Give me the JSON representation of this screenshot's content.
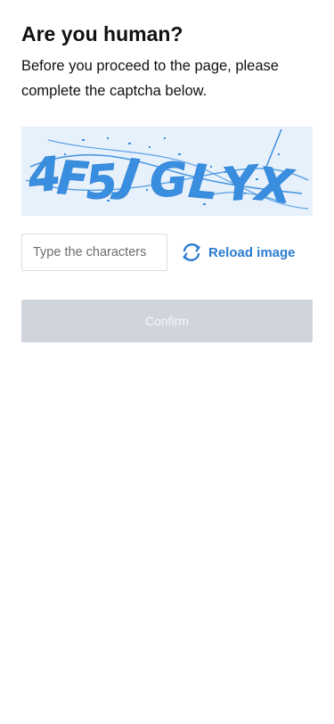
{
  "header": {
    "title": "Are you human?",
    "description": "Before you proceed to the page, please complete the captcha below."
  },
  "captcha": {
    "text": "4F5JGLYX",
    "text_color": "#3a8ee0",
    "background": "#e7f1fb"
  },
  "form": {
    "input_placeholder": "Type the characters",
    "input_value": "",
    "reload_label": "Reload image",
    "reload_icon": "refresh-icon",
    "confirm_label": "Confirm",
    "confirm_enabled": false
  },
  "colors": {
    "accent": "#2a7bd0",
    "confirm_disabled_bg": "#d0d5dc"
  }
}
